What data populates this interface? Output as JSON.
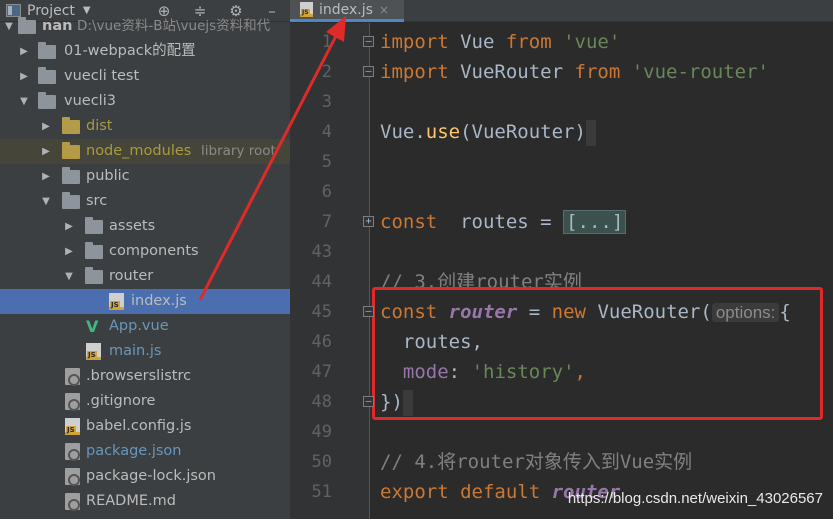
{
  "project_panel": {
    "title": "Project",
    "dropdown_icon": "chevron-down-icon",
    "toolbar_icons": [
      "crosshair-icon",
      "collapse-icon",
      "gear-icon",
      "hide-icon"
    ],
    "tree": [
      {
        "label": "nan",
        "extra": "D:\\vue资料-B站\\vuejs资料和代",
        "type": "folder",
        "expanded": true
      },
      {
        "label": "01-webpack的配置",
        "type": "folder"
      },
      {
        "label": "vuecli test",
        "type": "folder"
      },
      {
        "label": "vuecli3",
        "type": "folder",
        "expanded": true
      },
      {
        "label": "dist",
        "type": "folder-excluded"
      },
      {
        "label": "node_modules",
        "extra": "library root",
        "type": "folder-excluded"
      },
      {
        "label": "public",
        "type": "folder"
      },
      {
        "label": "src",
        "type": "folder",
        "expanded": true
      },
      {
        "label": "assets",
        "type": "folder"
      },
      {
        "label": "components",
        "type": "folder"
      },
      {
        "label": "router",
        "type": "folder",
        "expanded": true
      },
      {
        "label": "index.js",
        "type": "js",
        "selected": true
      },
      {
        "label": "App.vue",
        "type": "vue"
      },
      {
        "label": "main.js",
        "type": "js"
      },
      {
        "label": ".browserslistrc",
        "type": "config"
      },
      {
        "label": ".gitignore",
        "type": "config"
      },
      {
        "label": "babel.config.js",
        "type": "js"
      },
      {
        "label": "package.json",
        "type": "config"
      },
      {
        "label": "package-lock.json",
        "type": "config"
      },
      {
        "label": "README.md",
        "type": "md"
      }
    ]
  },
  "editor": {
    "tab": {
      "label": "index.js",
      "close": "×"
    },
    "line_numbers": [
      "1",
      "2",
      "3",
      "4",
      "5",
      "6",
      "7",
      "43",
      "44",
      "45",
      "46",
      "47",
      "48",
      "49",
      "50",
      "51"
    ],
    "code": {
      "l1": {
        "kw": "import",
        "name": "Vue",
        "from": "from",
        "str": "'vue'"
      },
      "l2": {
        "kw": "import",
        "name": "VueRouter",
        "from": "from",
        "str": "'vue-router'"
      },
      "l4": {
        "obj": "Vue.",
        "fn": "use",
        "args": "(VueRouter)"
      },
      "l7": {
        "kw": "const",
        "name": "routes =",
        "collapsed": "[...]"
      },
      "l44": {
        "comment": "// 3.创建router实例"
      },
      "l45": {
        "kw": "const",
        "var": "router",
        "eq": "=",
        "new": "new",
        "cls": "VueRouter(",
        "hint": "options:",
        "brace": "{"
      },
      "l46": {
        "text": "routes,"
      },
      "l47": {
        "prop": "mode",
        "colon": ":",
        "str": "'history'",
        "comma": ","
      },
      "l48": {
        "text": "})"
      },
      "l50": {
        "comment": "// 4.将router对象传入到Vue实例"
      },
      "l51": {
        "kw": "export default",
        "var": "router"
      }
    }
  },
  "watermark": "https://blog.csdn.net/weixin_43026567",
  "colors": {
    "annotation": "#e02a2a",
    "selection": "#4b6eaf"
  }
}
